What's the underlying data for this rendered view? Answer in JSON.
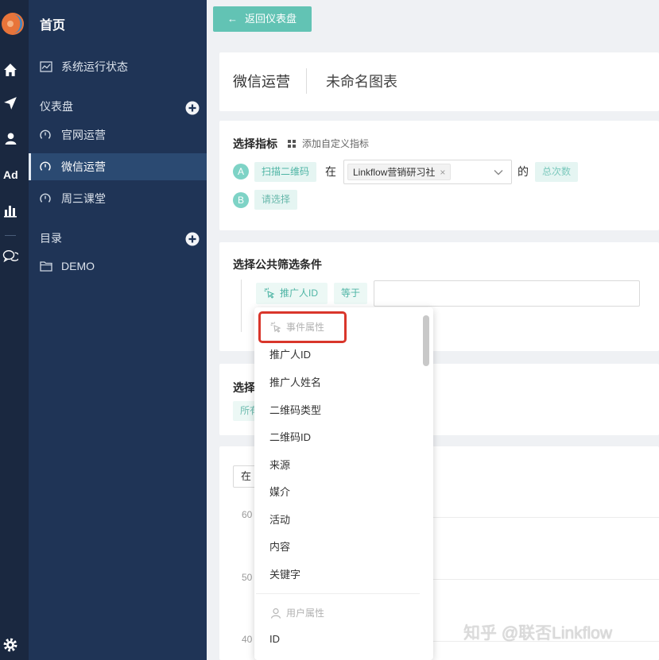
{
  "colors": {
    "rail_bg": "#1a2840",
    "sidebar_bg": "#1f3456",
    "sidebar_active_bg": "#2b4a72",
    "accent": "#62c3b4",
    "tag_bg": "#e5f5f2",
    "tag_text": "#4fb5a5",
    "highlight_border": "#d9362b",
    "page_bg": "#eff1f4"
  },
  "rail": {
    "icons": [
      "brand-logo",
      "home-icon",
      "send-icon",
      "user-icon",
      "ad-icon",
      "bar-chart-icon",
      "chat-icon",
      "gear-icon"
    ],
    "ad_label": "Ad"
  },
  "sidebar": {
    "home_label": "首页",
    "system_status_label": "系统运行状态",
    "dashboards_label": "仪表盘",
    "dashboards": [
      {
        "label": "官网运营",
        "active": false
      },
      {
        "label": "微信运营",
        "active": true
      },
      {
        "label": "周三课堂",
        "active": false
      }
    ],
    "catalog_label": "目录",
    "folders": [
      {
        "label": "DEMO"
      }
    ]
  },
  "back_button": {
    "arrow": "←",
    "label": "返回仪表盘"
  },
  "header": {
    "dashboard_name": "微信运营",
    "chart_name": "未命名图表"
  },
  "metrics": {
    "title": "选择指标",
    "add_custom_label": "添加自定义指标",
    "rows": [
      {
        "badge": "A",
        "event": "扫描二维码",
        "in_label": "在",
        "source": "Linkflow营销研习社",
        "remove_glyph": "×",
        "of_label": "的",
        "measure": "总次数"
      },
      {
        "badge": "B",
        "event_placeholder": "请选择"
      }
    ]
  },
  "filters": {
    "title": "选择公共筛选条件",
    "property": "推广人ID",
    "operator": "等于",
    "value": ""
  },
  "grouping": {
    "title": "选择",
    "value": "所有"
  },
  "chart_panel": {
    "range_label": "在",
    "y_ticks": [
      "60",
      "50",
      "40"
    ]
  },
  "dropdown": {
    "groups": [
      {
        "label": "事件属性",
        "icon": "cursor-click-icon",
        "highlighted": true,
        "items": [
          "推广人ID",
          "推广人姓名",
          "二维码类型",
          "二维码ID",
          "来源",
          "媒介",
          "活动",
          "内容",
          "关键字"
        ]
      },
      {
        "label": "用户属性",
        "icon": "person-icon",
        "items": [
          "ID"
        ]
      }
    ]
  },
  "watermark": "知乎 @联否Linkflow"
}
